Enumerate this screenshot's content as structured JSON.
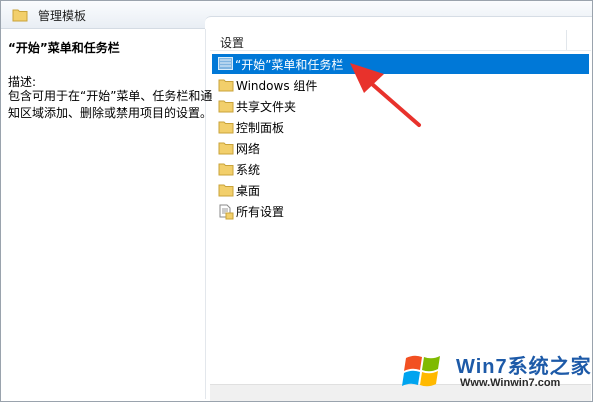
{
  "window": {
    "title": "管理模板",
    "title_icon": "folder-icon"
  },
  "left_pane": {
    "heading": "“开始”菜单和任务栏",
    "description_label": "描述:",
    "description_text": "包含可用于在“开始”菜单、任务栏和通知区域添加、删除或禁用项目的设置。"
  },
  "list": {
    "column_header": "设置",
    "items": [
      {
        "label": "“开始”菜单和任务栏",
        "icon": "settings-folder-icon",
        "selected": true
      },
      {
        "label": "Windows 组件",
        "icon": "folder-icon",
        "selected": false
      },
      {
        "label": "共享文件夹",
        "icon": "folder-icon",
        "selected": false
      },
      {
        "label": "控制面板",
        "icon": "folder-icon",
        "selected": false
      },
      {
        "label": "网络",
        "icon": "folder-icon",
        "selected": false
      },
      {
        "label": "系统",
        "icon": "folder-icon",
        "selected": false
      },
      {
        "label": "桌面",
        "icon": "folder-icon",
        "selected": false
      },
      {
        "label": "所有设置",
        "icon": "all-settings-icon",
        "selected": false
      }
    ]
  },
  "watermark": {
    "name": "Win7系统之家",
    "url": "Www.Winwin7.com"
  },
  "colors": {
    "selection": "#0078d7",
    "arrow": "#e8322c",
    "folder": "#f2cf6b"
  }
}
